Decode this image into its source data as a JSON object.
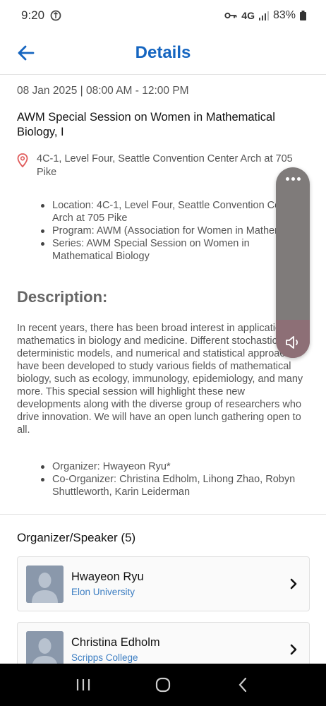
{
  "status_bar": {
    "time": "9:20",
    "network": "4G",
    "battery": "83%"
  },
  "header": {
    "title": "Details"
  },
  "event": {
    "date_time": "08 Jan 2025 | 08:00 AM - 12:00 PM",
    "title": "AWM Special Session on Women in Mathematical Biology, I",
    "location": "4C-1, Level Four, Seattle Convention Center Arch at 705 Pike",
    "info": [
      "Location: 4C-1, Level Four, Seattle Convention Center Arch at 705 Pike",
      "Program: AWM (Association for Women in Mathematics)",
      "Series: AWM Special Session on Women in Mathematical Biology"
    ],
    "description_heading": "Description:",
    "description": "In recent years, there has been broad interest in applications of mathematics in biology and medicine. Different stochastic and deterministic models, and numerical and statistical approaches have been developed to study various fields of mathematical biology, such as ecology, immunology, epidemiology, and many more. This special session will highlight these new developments along with the diverse group of researchers who drive innovation. We will have an open lunch gathering open to all.",
    "organizers": [
      "Organizer: Hwayeon Ryu*",
      "Co-Organizer: Christina Edholm, Lihong Zhao, Robyn Shuttleworth, Karin Leiderman"
    ]
  },
  "speakers_section": {
    "heading": "Organizer/Speaker (5)",
    "speakers": [
      {
        "name": "Hwayeon Ryu",
        "affiliation": "Elon University"
      },
      {
        "name": "Christina Edholm",
        "affiliation": "Scripps College"
      }
    ]
  },
  "volume_overlay": {
    "level": 0.2
  },
  "colors": {
    "accent": "#1565c0",
    "link": "#3b7dc2",
    "pin": "#e05a5a"
  }
}
